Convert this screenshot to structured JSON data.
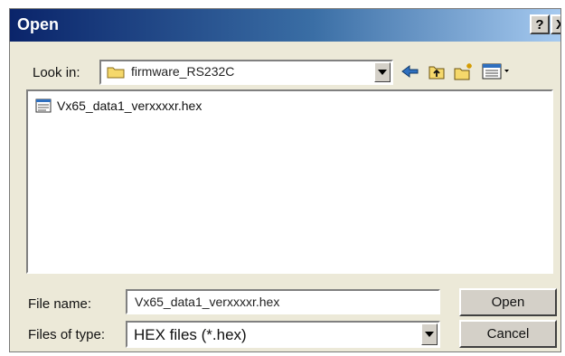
{
  "window": {
    "title": "Open",
    "help_label": "?",
    "close_label": "X"
  },
  "toolbar": {
    "look_in_label": "Look in:",
    "look_in_value": "firmware_RS232C",
    "icons": [
      "folder-icon",
      "back-arrow-icon",
      "up-folder-icon",
      "new-folder-icon",
      "views-menu-icon"
    ]
  },
  "file_list": {
    "items": [
      {
        "name": "Vx65_data1_verxxxxr.hex",
        "icon": "hex-file-icon"
      }
    ]
  },
  "fields": {
    "file_name_label": "File name:",
    "file_name_value": "Vx65_data1_verxxxxr.hex",
    "file_type_label": "Files of type:",
    "file_type_value": "HEX files (*.hex)"
  },
  "buttons": {
    "open": "Open",
    "cancel": "Cancel"
  },
  "colors": {
    "title_bar_start": "#0a246a",
    "title_bar_end": "#a6caf0",
    "dialog_face": "#ece9d8"
  }
}
